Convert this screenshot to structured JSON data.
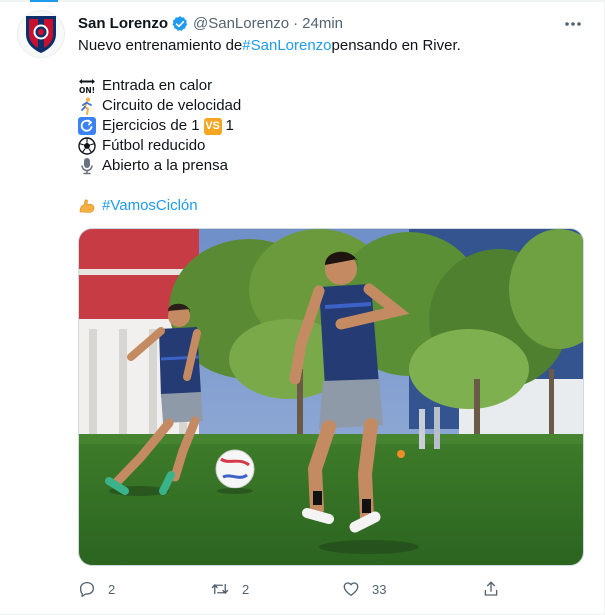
{
  "tweet": {
    "author_name": "San Lorenzo",
    "handle": "@SanLorenzo",
    "separator": "·",
    "time": "24min",
    "intro": {
      "before": "Nuevo entrenamiento de ",
      "hashtag": "#SanLorenzo",
      "after": " pensando en River."
    },
    "items": [
      {
        "icon": "on-arrow-icon",
        "text": "Entrada en calor"
      },
      {
        "icon": "runner-icon",
        "text": "Circuito de velocidad"
      },
      {
        "icon": "clockwise-arrow-icon",
        "text": "Ejercicios de 1",
        "badge": "VS",
        "after": " 1"
      },
      {
        "icon": "soccer-ball-icon",
        "text": "Fútbol reducido"
      },
      {
        "icon": "microphone-icon",
        "text": "Abierto a la prensa"
      }
    ],
    "closing_hashtag": "#VamosCiclón",
    "closing_icon": "flexed-biceps-icon",
    "media_alt": "",
    "actions": {
      "replies": "2",
      "retweets": "2",
      "likes": "33"
    }
  },
  "colors": {
    "link": "#1d9bf0",
    "secondary": "#536471",
    "text": "#0f1419",
    "brand_red": "#c8102e",
    "brand_blue": "#0a2f6b"
  }
}
